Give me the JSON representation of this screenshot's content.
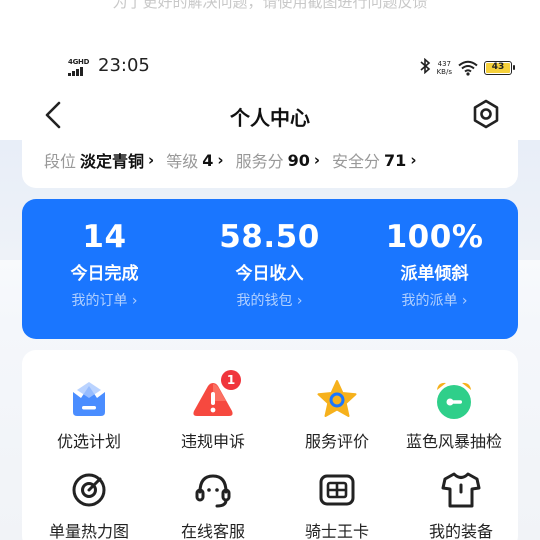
{
  "top_hint": "为了更好的解决问题，请使用截图进行问题反馈",
  "status_bar": {
    "network": "4GHD",
    "time": "23:05",
    "speed_value": "437",
    "speed_unit": "KB/s",
    "battery": "43"
  },
  "nav": {
    "title": "个人中心"
  },
  "rank": {
    "items": [
      {
        "label": "段位",
        "value": "淡定青铜"
      },
      {
        "label": "等级",
        "value": "4"
      },
      {
        "label": "服务分",
        "value": "90"
      },
      {
        "label": "安全分",
        "value": "71"
      }
    ]
  },
  "stats": [
    {
      "value": "14",
      "label": "今日完成",
      "link": "我的订单"
    },
    {
      "value": "58.50",
      "label": "今日收入",
      "link": "我的钱包"
    },
    {
      "value": "100%",
      "label": "派单倾斜",
      "link": "我的派单"
    }
  ],
  "menu": {
    "items": [
      {
        "label": "优选计划",
        "icon": "crown-icon"
      },
      {
        "label": "违规申诉",
        "icon": "warning-icon",
        "badge": "1"
      },
      {
        "label": "服务评价",
        "icon": "star-icon"
      },
      {
        "label": "蓝色风暴抽检",
        "icon": "alarm-clock-icon"
      },
      {
        "label": "单量热力图",
        "icon": "heatmap-icon"
      },
      {
        "label": "在线客服",
        "icon": "headset-icon"
      },
      {
        "label": "骑士王卡",
        "icon": "sim-card-icon"
      },
      {
        "label": "我的装备",
        "icon": "tshirt-icon"
      }
    ]
  },
  "colors": {
    "accent": "#1a76ff",
    "badge": "#f0353c",
    "star": "#f6b11c",
    "green": "#2fcf8a"
  }
}
